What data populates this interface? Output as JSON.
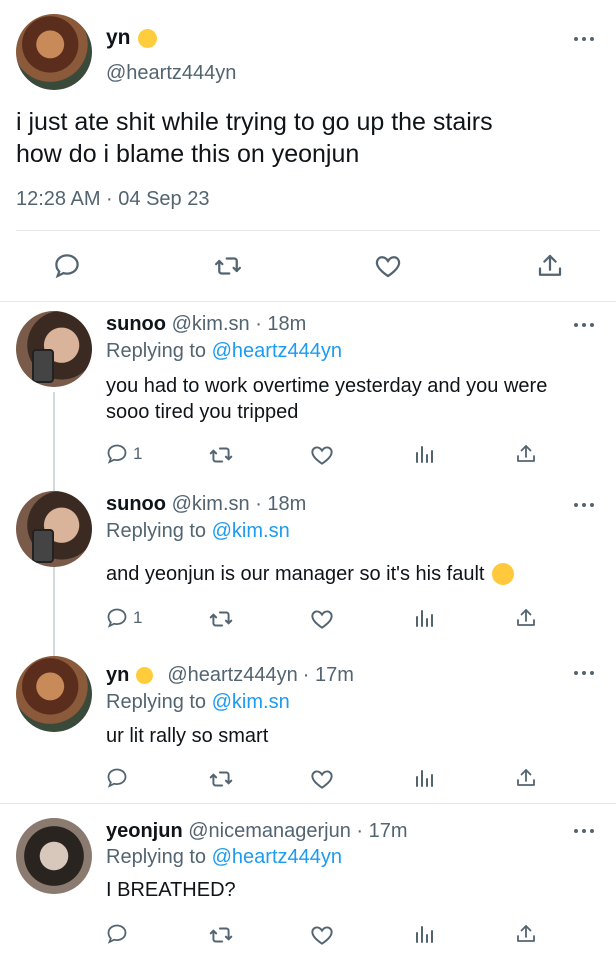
{
  "main": {
    "name": "yn",
    "handle": "@heartz444yn",
    "text_line1": "i just ate shit while trying to go up the stairs",
    "text_line2": "how do i blame this on yeonjun",
    "timestamp": "12:28 AM · 04 Sep 23"
  },
  "replies": [
    {
      "name": "sunoo",
      "handle": "@kim.sn",
      "time": "· 18m",
      "replying_label": "Replying to",
      "replying_to": "@heartz444yn",
      "text_line1": "you had to work overtime yesterday and you were",
      "text_line2": "sooo tired you tripped",
      "reply_count": "1"
    },
    {
      "name": "sunoo",
      "handle": "@kim.sn",
      "time": "· 18m",
      "replying_label": "Replying to",
      "replying_to": "@kim.sn",
      "text_line1": "and yeonjun is our manager so it's his fault",
      "reply_count": "1"
    },
    {
      "name": "yn",
      "handle": "@heartz444yn",
      "time": "· 17m",
      "replying_label": "Replying to",
      "replying_to": "@kim.sn",
      "text_line1": "ur lit rally so smart"
    },
    {
      "name": "yeonjun",
      "handle": "@nicemanagerjun",
      "time": "· 17m",
      "replying_label": "Replying to",
      "replying_to": "@heartz444yn",
      "text_line1": "I BREATHED?"
    }
  ],
  "icons": {
    "reply": "speech-bubble-icon",
    "retweet": "retweet-arrows-icon",
    "like": "heart-outline-icon",
    "share": "share-upload-icon",
    "analytics": "bar-chart-icon",
    "more": "more-dots-icon",
    "emoji_blush": "blushing-face-emoji",
    "emoji_hug": "hugging-face-emoji"
  },
  "colors": {
    "link": "#1d9bf0",
    "muted": "#536471",
    "text": "#0f1419",
    "thread_line": "#cfd9de"
  }
}
